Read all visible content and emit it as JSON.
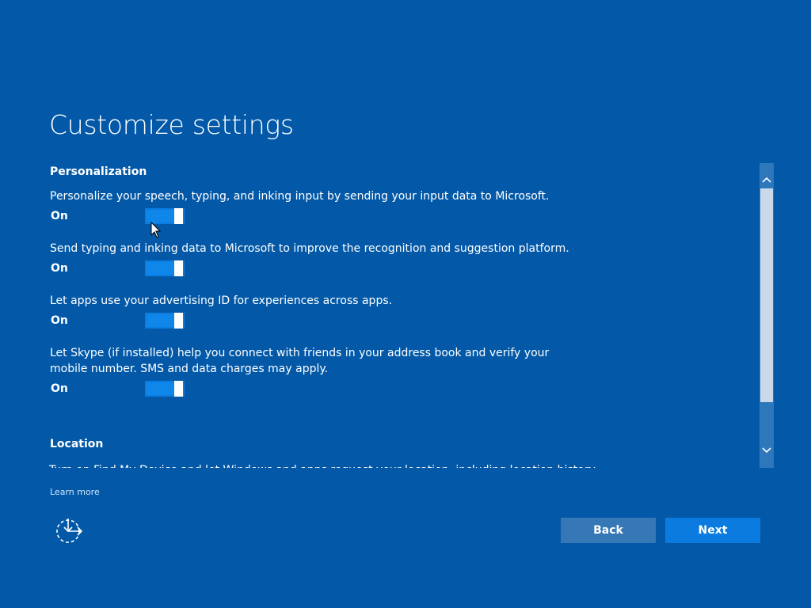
{
  "title": "Customize settings",
  "personalization": {
    "heading": "Personalization",
    "settings": [
      {
        "description": "Personalize your speech, typing, and inking input by sending your input data to Microsoft.",
        "state": "On"
      },
      {
        "description": "Send typing and inking data to Microsoft to improve the recognition and suggestion platform.",
        "state": "On"
      },
      {
        "description": "Let apps use your advertising ID for experiences across apps.",
        "state": "On"
      },
      {
        "description": "Let Skype (if installed) help you connect with friends in your address book and verify your mobile number. SMS and data charges may apply.",
        "state": "On"
      }
    ]
  },
  "location": {
    "heading": "Location",
    "partial_text": "Turn on Find My Device and let Windows and apps request your location, including location history"
  },
  "learn_more": "Learn more",
  "buttons": {
    "back": "Back",
    "next": "Next"
  },
  "icons": {
    "ease_of_access": "ease-of-access-icon",
    "scroll_up": "chevron-up-icon",
    "scroll_down": "chevron-down-icon"
  },
  "colors": {
    "background": "#0359a8",
    "toggle_on": "#0f86ea",
    "next_button": "#0b7be0",
    "back_button": "#3678b6"
  }
}
